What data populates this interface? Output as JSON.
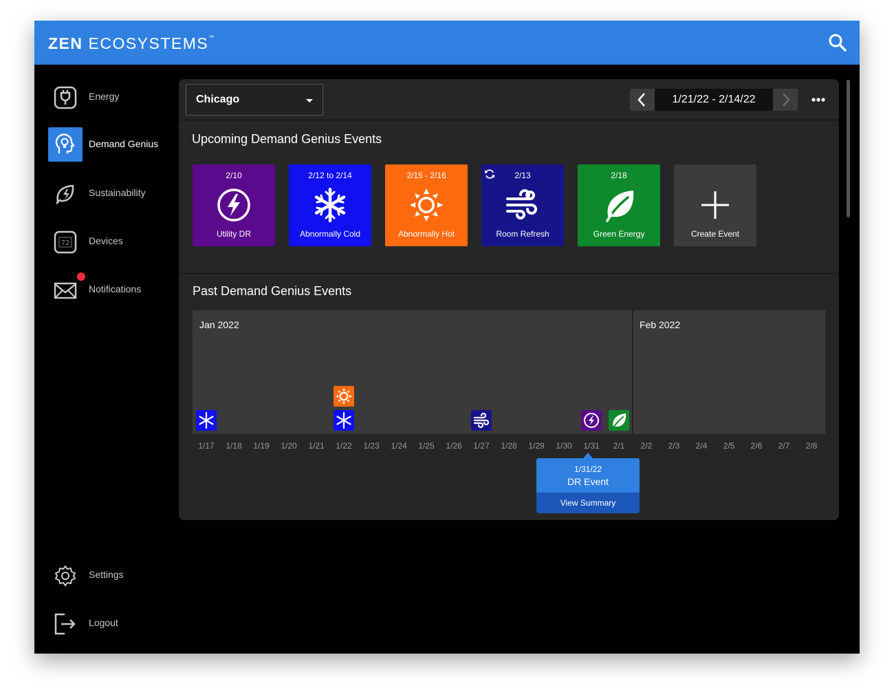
{
  "brand": {
    "bold": "ZEN",
    "light": "ECOSYSTEMS",
    "tm": "™"
  },
  "sidebar": {
    "items": [
      {
        "label": "Energy",
        "icon": "plug-icon"
      },
      {
        "label": "Demand Genius",
        "icon": "head-lightbulb-icon",
        "active": true
      },
      {
        "label": "Sustainability",
        "icon": "leaf-bolt-icon"
      },
      {
        "label": "Devices",
        "icon": "thermostat-icon",
        "icon_text": "72"
      },
      {
        "label": "Notifications",
        "icon": "envelope-icon",
        "badge": true
      }
    ],
    "bottom": [
      {
        "label": "Settings",
        "icon": "gear-icon"
      },
      {
        "label": "Logout",
        "icon": "logout-icon"
      }
    ]
  },
  "header": {
    "city": "Chicago",
    "date_range": "1/21/22 - 2/14/22"
  },
  "upcoming": {
    "title": "Upcoming Demand Genius Events",
    "tiles": [
      {
        "date": "2/10",
        "label": "Utility DR",
        "color": "#5a0a8c",
        "icon": "lightning-circle-icon"
      },
      {
        "date": "2/12 to 2/14",
        "label": "Abnormally Cold",
        "color": "#1010f0",
        "icon": "snowflake-icon"
      },
      {
        "date": "2/15 - 2/16",
        "label": "Abnormally Hot",
        "color": "#ff6a0f",
        "icon": "sun-icon"
      },
      {
        "date": "2/13",
        "label": "Room Refresh",
        "color": "#17148a",
        "icon": "wind-icon",
        "recurring": true
      },
      {
        "date": "2/18",
        "label": "Green Energy",
        "color": "#0e8a2c",
        "icon": "leaf-icon"
      },
      {
        "date": "",
        "label": "Create Event",
        "color": "#3c3c3c",
        "icon": "plus-icon"
      }
    ]
  },
  "past": {
    "title": "Past Demand Genius Events",
    "months": [
      "Jan 2022",
      "Feb 2022"
    ],
    "ticks": [
      "1/17",
      "1/18",
      "1/19",
      "1/20",
      "1/21",
      "1/22",
      "1/23",
      "1/24",
      "1/25",
      "1/26",
      "1/27",
      "1/28",
      "1/29",
      "1/30",
      "1/31",
      "2/1",
      "2/2",
      "2/3",
      "2/4",
      "2/5",
      "2/6",
      "2/7",
      "2/8"
    ],
    "events": [
      {
        "date": "1/17",
        "type": "cold",
        "stack": 0
      },
      {
        "date": "1/22",
        "type": "cold",
        "stack": 0
      },
      {
        "date": "1/22",
        "type": "hot",
        "stack": 1
      },
      {
        "date": "1/27",
        "type": "refresh",
        "stack": 0
      },
      {
        "date": "1/31",
        "type": "dr",
        "stack": 0
      },
      {
        "date": "2/1",
        "type": "green",
        "stack": 0
      }
    ]
  },
  "tooltip": {
    "date": "1/31/22",
    "event": "DR Event",
    "action": "View Summary"
  },
  "colors": {
    "accent": "#2f80e0",
    "dr": "#5a0a8c",
    "cold": "#1010f0",
    "hot": "#ff6a0f",
    "refresh": "#17148a",
    "green": "#0e8a2c",
    "notification": "#ff2d3c"
  }
}
